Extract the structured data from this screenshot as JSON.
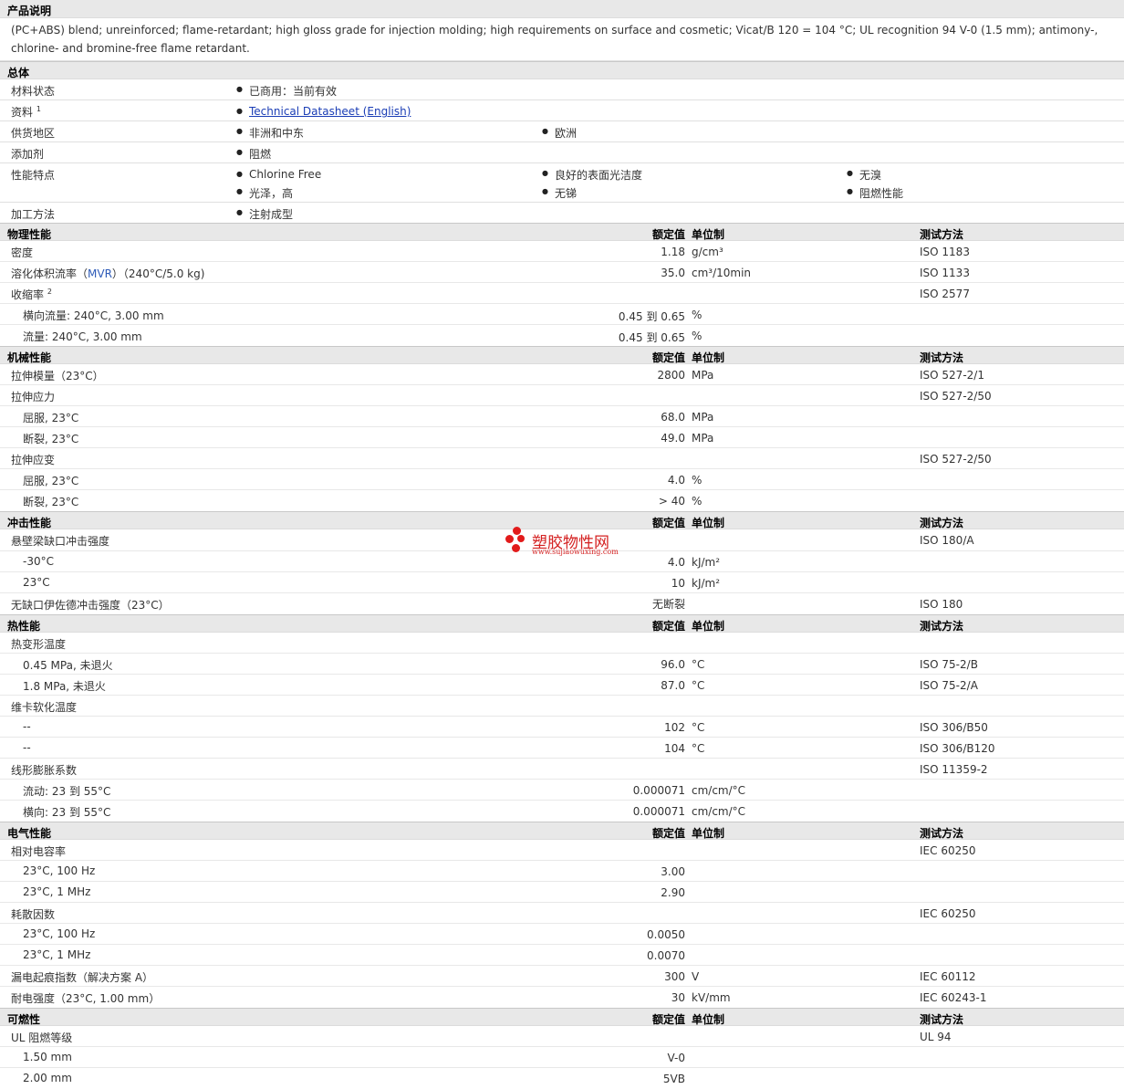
{
  "desc": {
    "title": "产品说明",
    "text": "(PC+ABS) blend; unreinforced; flame-retardant; high gloss grade for injection molding; high requirements on surface and cosmetic; Vicat/B 120 = 104 °C; UL recognition 94 V-0 (1.5 mm); antimony-, chlorine- and bromine-free flame retardant."
  },
  "general": {
    "title": "总体",
    "material_status": {
      "label": "材料状态",
      "value": "已商用：当前有效"
    },
    "literature": {
      "label": "资料",
      "sup": "1",
      "link": "Technical Datasheet (English)"
    },
    "availability": {
      "label": "供货地区",
      "items": [
        "非洲和中东",
        "欧洲"
      ]
    },
    "additive": {
      "label": "添加剂",
      "value": "阻燃"
    },
    "features": {
      "label": "性能特点",
      "items": [
        "Chlorine Free",
        "良好的表面光洁度",
        "无溴",
        "光泽，高",
        "无锑",
        "阻燃性能"
      ]
    },
    "processing": {
      "label": "加工方法",
      "value": "注射成型"
    }
  },
  "col_headers": {
    "value": "额定值",
    "unit": "单位制",
    "method": "测试方法"
  },
  "sections": {
    "physical": {
      "title": "物理性能",
      "rows": [
        {
          "name": "密度",
          "value": "1.18",
          "unit": "g/cm³",
          "method": "ISO 1183"
        },
        {
          "name_a": "溶化体积流率（",
          "name_b": "MVR",
          "name_c": "）（240°C/5.0 kg)",
          "value": "35.0",
          "unit": "cm³/10min",
          "method": "ISO 1133"
        },
        {
          "name": "收缩率",
          "sup": "2",
          "method": "ISO 2577"
        },
        {
          "name": "横向流量: 240°C, 3.00 mm",
          "value": "0.45 到  0.65",
          "unit": "%"
        },
        {
          "name": "流量: 240°C, 3.00 mm",
          "value": "0.45 到  0.65",
          "unit": "%"
        }
      ]
    },
    "mechanical": {
      "title": "机械性能",
      "rows": [
        {
          "name": "拉伸模量（23°C）",
          "value": "2800",
          "unit": "MPa",
          "method": "ISO 527-2/1"
        },
        {
          "name": "拉伸应力",
          "method": "ISO 527-2/50"
        },
        {
          "name": "屈服, 23°C",
          "value": "68.0",
          "unit": "MPa"
        },
        {
          "name": "断裂, 23°C",
          "value": "49.0",
          "unit": "MPa"
        },
        {
          "name": "拉伸应变",
          "method": "ISO 527-2/50"
        },
        {
          "name": "屈服, 23°C",
          "value": "4.0",
          "unit": "%"
        },
        {
          "name": "断裂, 23°C",
          "value": "> 40",
          "unit": "%"
        }
      ]
    },
    "impact": {
      "title": "冲击性能",
      "rows": [
        {
          "name": "悬壁梁缺口冲击强度",
          "method": "ISO 180/A"
        },
        {
          "name": "-30°C",
          "value": "4.0",
          "unit": "kJ/m²"
        },
        {
          "name": "23°C",
          "value": "10",
          "unit": "kJ/m²"
        },
        {
          "name": "无缺口伊佐德冲击强度（23°C）",
          "value": "无断裂",
          "method": "ISO 180"
        }
      ]
    },
    "thermal": {
      "title": "热性能",
      "rows": [
        {
          "name": "热变形温度"
        },
        {
          "name": "0.45 MPa, 未退火",
          "value": "96.0",
          "unit": "°C",
          "method": "ISO 75-2/B"
        },
        {
          "name": "1.8 MPa, 未退火",
          "value": "87.0",
          "unit": "°C",
          "method": "ISO 75-2/A"
        },
        {
          "name": "维卡软化温度"
        },
        {
          "name": "--",
          "value": "102",
          "unit": "°C",
          "method": "ISO 306/B50"
        },
        {
          "name": "--",
          "value": "104",
          "unit": "°C",
          "method": "ISO 306/B120"
        },
        {
          "name": "线形膨胀系数",
          "method": "ISO 11359-2"
        },
        {
          "name": "流动: 23 到  55°C",
          "value": "0.000071",
          "unit": "cm/cm/°C"
        },
        {
          "name": "横向: 23 到  55°C",
          "value": "0.000071",
          "unit": "cm/cm/°C"
        }
      ]
    },
    "electrical": {
      "title": "电气性能",
      "rows": [
        {
          "name": "相对电容率",
          "method": "IEC 60250"
        },
        {
          "name": "23°C, 100 Hz",
          "value": "3.00"
        },
        {
          "name": "23°C, 1 MHz",
          "value": "2.90"
        },
        {
          "name": "耗散因数",
          "method": "IEC 60250"
        },
        {
          "name": "23°C, 100 Hz",
          "value": "0.0050"
        },
        {
          "name": "23°C, 1 MHz",
          "value": "0.0070"
        },
        {
          "name": "漏电起痕指数（解决方案  A）",
          "value": "300",
          "unit": "V",
          "method": "IEC 60112"
        },
        {
          "name": "耐电强度（23°C, 1.00 mm）",
          "value": "30",
          "unit": "kV/mm",
          "method": "IEC 60243-1"
        }
      ]
    },
    "flammability": {
      "title": "可燃性",
      "rows": [
        {
          "name": "UL 阻燃等级",
          "method": "UL 94"
        },
        {
          "name": "1.50 mm",
          "value": "V-0"
        },
        {
          "name": "2.00 mm",
          "value": "5VB"
        }
      ]
    }
  },
  "watermark": {
    "text": "塑胶物性网",
    "url": "www.sujiaowuxing.com"
  }
}
